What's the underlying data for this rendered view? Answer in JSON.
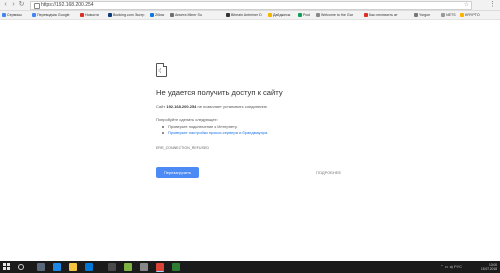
{
  "browser": {
    "url": "https://192.168.200.254"
  },
  "bookmarks": [
    {
      "label": "Сервисы",
      "color": "#4285f4"
    },
    {
      "label": "Переводчик Google",
      "color": "#4285f4"
    },
    {
      "label": "Новости",
      "color": "#d93025"
    },
    {
      "label": "Booking.com Экстр",
      "color": "#0c3b7c"
    },
    {
      "label": "Zillow",
      "color": "#1277e1"
    },
    {
      "label": "Анкета Miner Su",
      "color": "#6f6f6f"
    },
    {
      "label": "Bitmain Antminer D",
      "color": "#333333"
    },
    {
      "label": "Дайджесы",
      "color": "#f4b400"
    },
    {
      "label": "Pool",
      "color": "#0f9d58"
    },
    {
      "label": "Welcome to the Gar",
      "color": "#888888"
    },
    {
      "label": "Как отключить ат",
      "color": "#d93025"
    },
    {
      "label": "Yorgon",
      "color": "#777777"
    },
    {
      "label": "NETS",
      "color": "#999999"
    },
    {
      "label": "KRYPTO",
      "color": "#ffb300"
    }
  ],
  "error": {
    "title": "Не удается получить доступ к сайту",
    "desc_prefix": "Сайт",
    "host": "192.168.200.254",
    "desc_suffix": "не позволяет установить соединение.",
    "try_label": "Попробуйте сделать следующее:",
    "suggestions": [
      "Проверьте подключение к Интернету.",
      "Проверьте настройки прокси-сервера и брандмауэра."
    ],
    "code": "ERR_CONNECTION_REFUSED",
    "reload_label": "Перезагрузить",
    "details_label": "ПОДРОБНЕЕ"
  },
  "taskbar": {
    "time": "13:00",
    "date": "15.07.2018",
    "lang": "РУС"
  },
  "colors": {
    "accent": "#4c8bf5",
    "link": "#1a73e8"
  }
}
